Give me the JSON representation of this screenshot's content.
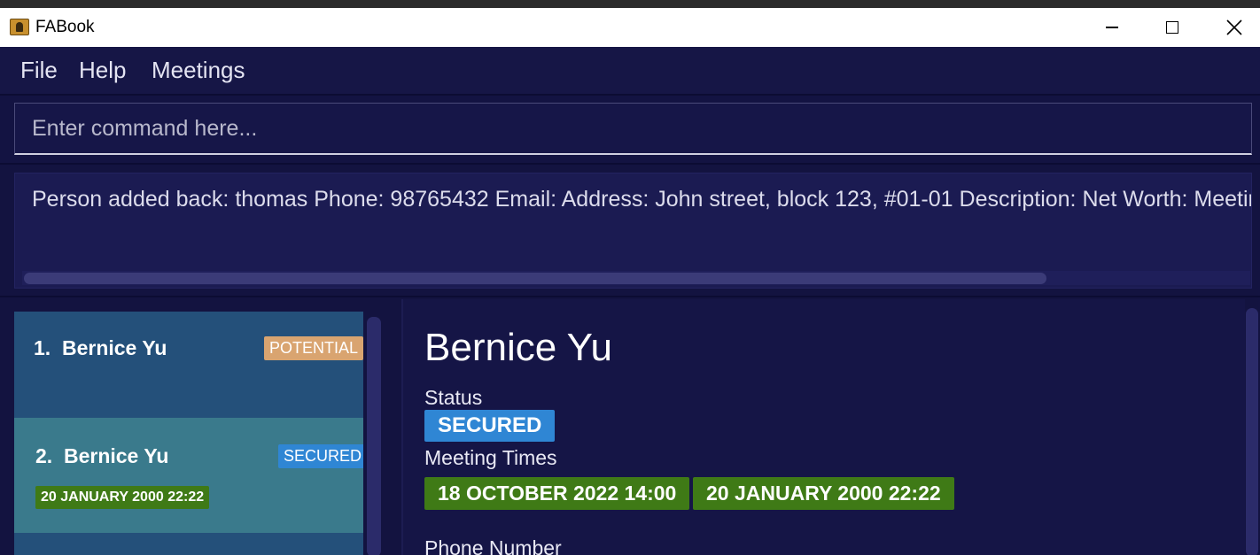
{
  "window": {
    "title": "FABook"
  },
  "menu": {
    "items": [
      "File",
      "Help",
      "Meetings"
    ]
  },
  "command": {
    "placeholder": "Enter command here...",
    "value": ""
  },
  "result": {
    "text": "Person added back: thomas Phone: 98765432 Email:  Address: John street, block 123, #01-01 Description:  Net Worth:  Meeting"
  },
  "person_list": [
    {
      "index": "1.",
      "name": "Bernice Yu",
      "tag": "POTENTIAL",
      "meetings": []
    },
    {
      "index": "2.",
      "name": "Bernice Yu",
      "tag": "SECURED",
      "meetings": [
        "20 JANUARY 2000 22:22"
      ]
    }
  ],
  "detail": {
    "name": "Bernice Yu",
    "status_label": "Status",
    "status": "SECURED",
    "meeting_label": "Meeting Times",
    "meetings": [
      "18 OCTOBER 2022 14:00",
      "20 JANUARY 2000 22:22"
    ],
    "phone_label": "Phone Number"
  },
  "colors": {
    "background": "#141442",
    "card": "#24507a",
    "card_selected": "#3a7a8c",
    "tag_potential": "#d9a470",
    "tag_secured": "#2f86d4",
    "tag_meeting": "#3f7a16"
  }
}
